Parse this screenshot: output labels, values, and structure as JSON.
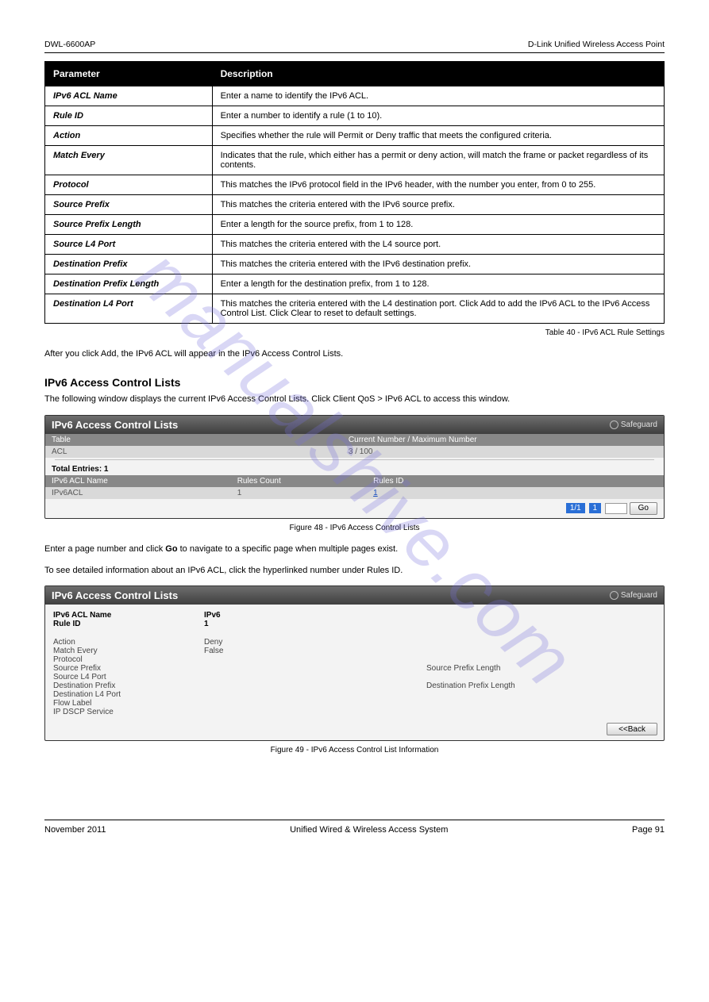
{
  "header": {
    "left": "DWL-6600AP",
    "right": "D-Link Unified Wireless Access Point"
  },
  "param_table": {
    "headers": [
      "Parameter",
      "Description"
    ],
    "rows": [
      [
        "IPv6 ACL Name",
        "Enter a name to identify the IPv6 ACL."
      ],
      [
        "Rule ID",
        "Enter a number to identify a rule (1 to 10)."
      ],
      [
        "Action",
        "Specifies whether the rule will Permit or Deny traffic that meets the configured criteria."
      ],
      [
        "Match Every",
        "Indicates that the rule, which either has a permit or deny action, will match the frame or packet regardless of its contents."
      ],
      [
        "Protocol",
        "This matches the IPv6 protocol field in the IPv6 header, with the number you enter, from 0 to 255."
      ],
      [
        "Source Prefix",
        "This matches the criteria entered with the IPv6 source prefix."
      ],
      [
        "Source Prefix Length",
        "Enter a length for the source prefix, from 1 to 128."
      ],
      [
        "Source L4 Port",
        "This matches the criteria entered with the L4 source port."
      ],
      [
        "Destination Prefix",
        "This matches the criteria entered with the IPv6 destination prefix."
      ],
      [
        "Destination Prefix Length",
        "Enter a length for the destination prefix, from 1 to 128."
      ],
      [
        "Destination L4 Port",
        "This matches the criteria entered with the L4 destination port. Click Add to add the IPv6 ACL to the IPv6 Access Control List. Click Clear to reset to default settings."
      ]
    ],
    "caption": "Table 40 - IPv6 ACL Rule Settings"
  },
  "para1": "After you click Add, the IPv6 ACL will appear in the IPv6 Access Control Lists.",
  "section1": {
    "title": "IPv6 Access Control Lists",
    "nav": "The following window displays the current IPv6 Access Control Lists. Click Client QoS > IPv6 ACL to access this window."
  },
  "figure1": {
    "panel_title": "IPv6 Access Control Lists",
    "safeguard": "Safeguard",
    "tbl1_headers": [
      "Table",
      "Current Number / Maximum Number"
    ],
    "tbl1_row": [
      "ACL",
      "3 / 100"
    ],
    "total": "Total Entries: 1",
    "tbl2_headers": [
      "IPv6 ACL Name",
      "Rules Count",
      "Rules ID"
    ],
    "tbl2_row": [
      "IPv6ACL",
      "1",
      "1"
    ],
    "pager": {
      "pages": "1/1",
      "page": "1",
      "go": "Go"
    },
    "caption": "Figure 48 - IPv6 Access Control Lists"
  },
  "para2": {
    "text1": "Enter a page number and click ",
    "bold1": "Go",
    "text2": " to navigate to a specific page when multiple pages exist.",
    "text3": "To see detailed information about an IPv6 ACL, click the hyperlinked number under Rules ID."
  },
  "figure2": {
    "panel_title": "IPv6 Access Control Lists",
    "safeguard": "Safeguard",
    "rows": [
      [
        "IPv6 ACL Name",
        "IPv6",
        "",
        ""
      ],
      [
        "Rule ID",
        "1",
        "",
        ""
      ]
    ],
    "rows2": [
      [
        "Action",
        "Deny",
        "",
        ""
      ],
      [
        "Match Every",
        "False",
        "",
        ""
      ],
      [
        "Protocol",
        "",
        "",
        ""
      ],
      [
        "Source Prefix",
        "",
        "Source Prefix Length",
        ""
      ],
      [
        "Source L4 Port",
        "",
        "",
        ""
      ],
      [
        "Destination Prefix",
        "",
        "Destination Prefix Length",
        ""
      ],
      [
        "Destination L4 Port",
        "",
        "",
        ""
      ],
      [
        "Flow Label",
        "",
        "",
        ""
      ],
      [
        "IP DSCP Service",
        "",
        "",
        ""
      ]
    ],
    "back": "<<Back",
    "caption": "Figure 49 - IPv6 Access Control List Information"
  },
  "footer": {
    "left": "November 2011",
    "center": "Unified Wired & Wireless Access System",
    "right": "Page 91"
  },
  "watermark": "manualshive.com"
}
